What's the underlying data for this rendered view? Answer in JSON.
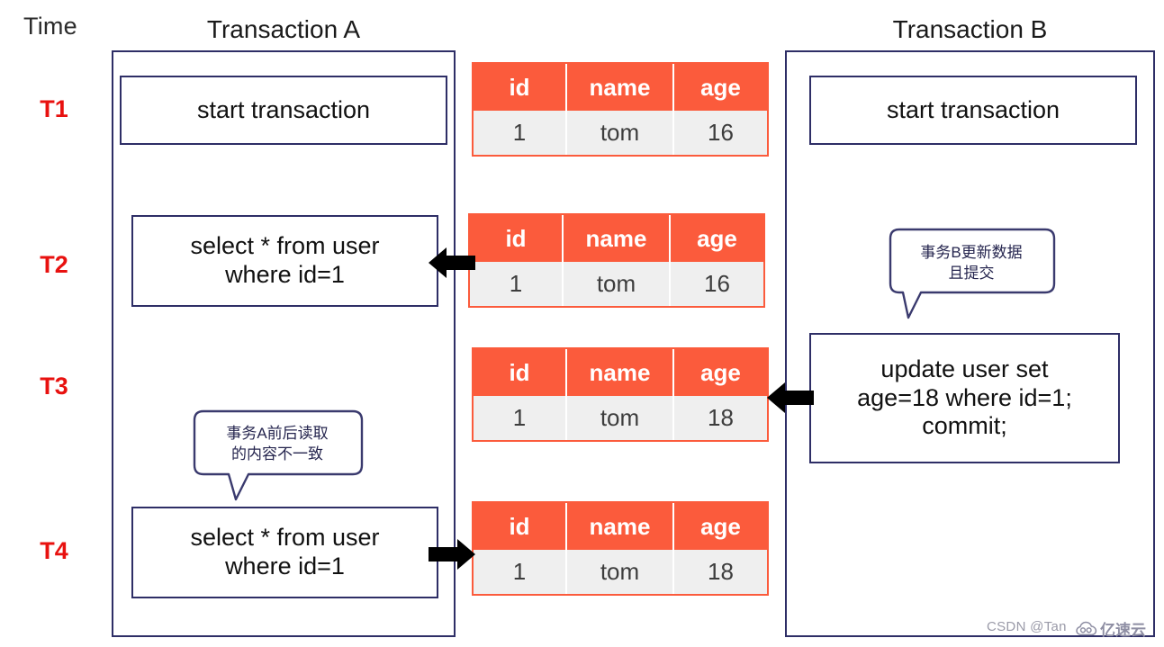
{
  "header": {
    "time_label": "Time",
    "column_a_title": "Transaction A",
    "column_b_title": "Transaction B"
  },
  "timeline": {
    "ticks": [
      {
        "label": "T1"
      },
      {
        "label": "T2"
      },
      {
        "label": "T3"
      },
      {
        "label": "T4"
      }
    ],
    "tick_color": "#e8110f"
  },
  "transaction_a": {
    "title": "Transaction A",
    "statements": [
      {
        "time": "T1",
        "text": "start transaction"
      },
      {
        "time": "T2",
        "text": "select * from user\nwhere id=1"
      },
      {
        "time": "T4",
        "text": "select * from user\nwhere id=1"
      }
    ]
  },
  "transaction_b": {
    "title": "Transaction B",
    "statements": [
      {
        "time": "T1",
        "text": "start transaction"
      },
      {
        "time": "T3",
        "text": "update user set\nage=18 where id=1;\ncommit;"
      }
    ]
  },
  "tables": {
    "columns": [
      "id",
      "name",
      "age"
    ],
    "snapshots": [
      {
        "time": "T1",
        "row": [
          "1",
          "tom",
          "16"
        ]
      },
      {
        "time": "T2",
        "row": [
          "1",
          "tom",
          "16"
        ]
      },
      {
        "time": "T3",
        "row": [
          "1",
          "tom",
          "18"
        ]
      },
      {
        "time": "T4",
        "row": [
          "1",
          "tom",
          "18"
        ]
      }
    ],
    "header_color": "#fb5b3c",
    "body_color": "#efefef",
    "border_color": "#fb5b3c"
  },
  "arrows": [
    {
      "time": "T2",
      "direction": "left",
      "meaning": "table-read-into-transaction-a"
    },
    {
      "time": "T3",
      "direction": "left",
      "meaning": "transaction-b-writes-table"
    },
    {
      "time": "T4",
      "direction": "right",
      "meaning": "transaction-a-reads-table-again"
    }
  ],
  "callouts": [
    {
      "id": "callout-a",
      "text": "事务A前后读取\n的内容不一致",
      "tail": "bottom-left"
    },
    {
      "id": "callout-b",
      "text": "事务B更新数据\n且提交",
      "tail": "bottom-left"
    }
  ],
  "watermark": {
    "csdn": "CSDN @Tan",
    "logo_text": "亿速云"
  },
  "colors": {
    "box_border": "#2e2e66",
    "accent_orange": "#fb5b3c",
    "tick_red": "#e8110f",
    "callout_border": "#3a3a6e"
  }
}
